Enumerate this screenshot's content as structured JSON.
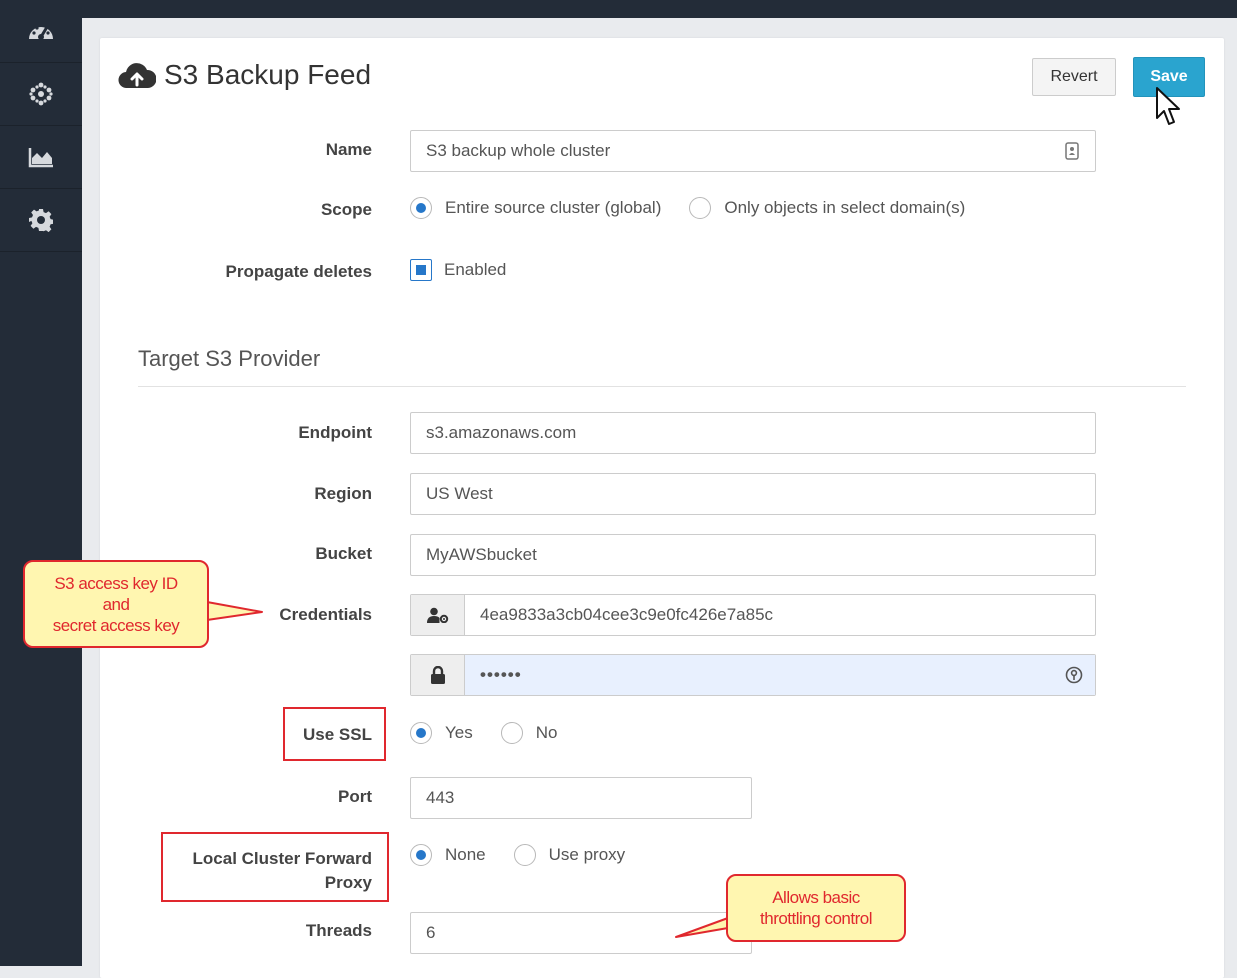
{
  "page": {
    "title": "S3 Backup Feed",
    "buttons": {
      "revert": "Revert",
      "save": "Save"
    }
  },
  "sidebar": {
    "items": [
      {
        "icon": "dashboard-icon"
      },
      {
        "icon": "cluster-icon"
      },
      {
        "icon": "area-chart-icon"
      },
      {
        "icon": "gear-icon"
      }
    ]
  },
  "form": {
    "name": {
      "label": "Name",
      "value": "S3 backup whole cluster"
    },
    "scope": {
      "label": "Scope",
      "options": [
        "Entire source cluster (global)",
        "Only objects in select domain(s)"
      ],
      "selected": 0
    },
    "propagate_deletes": {
      "label": "Propagate deletes",
      "option": "Enabled",
      "checked": true
    },
    "section_title": "Target S3 Provider",
    "endpoint": {
      "label": "Endpoint",
      "value": "s3.amazonaws.com"
    },
    "region": {
      "label": "Region",
      "value": "US West"
    },
    "bucket": {
      "label": "Bucket",
      "value": "MyAWSbucket"
    },
    "credentials": {
      "label": "Credentials",
      "access_key": "4ea9833a3cb04cee3c9e0fc426e7a85c",
      "secret_mask": "••••••"
    },
    "use_ssl": {
      "label": "Use SSL",
      "options": [
        "Yes",
        "No"
      ],
      "selected": 0
    },
    "port": {
      "label": "Port",
      "value": "443"
    },
    "forward_proxy": {
      "label_line1": "Local Cluster Forward",
      "label_line2": "Proxy",
      "options": [
        "None",
        "Use proxy"
      ],
      "selected": 0
    },
    "threads": {
      "label": "Threads",
      "value": "6"
    }
  },
  "annotations": {
    "credentials_callout": [
      "S3 access key ID",
      "and",
      "secret access key"
    ],
    "threads_callout": [
      "Allows basic",
      "throttling control"
    ]
  },
  "colors": {
    "accent": "#2aa4cf",
    "sidebar": "#232c38",
    "annotation": "#e0282e",
    "callout_fill": "#fff6b0"
  }
}
